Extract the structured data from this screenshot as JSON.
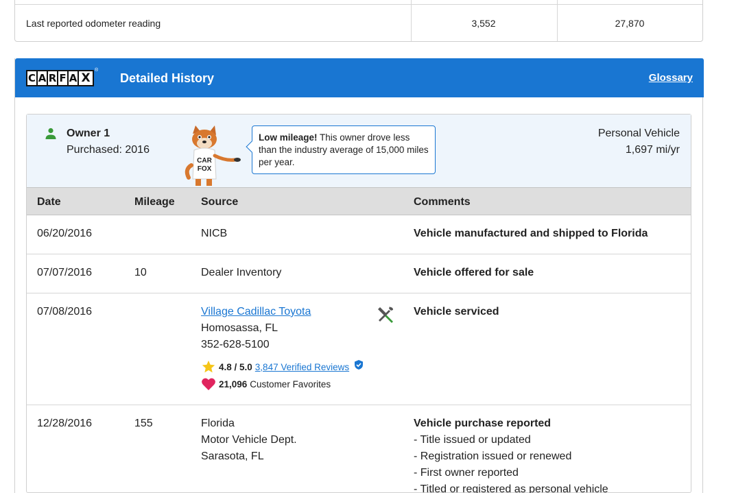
{
  "summary": {
    "label": "Last reported odometer reading",
    "values": [
      "3,552",
      "27,870"
    ]
  },
  "header": {
    "logo_letters": [
      "C",
      "A",
      "R",
      "F",
      "A",
      "X"
    ],
    "logo_reg": "®",
    "title": "Detailed History",
    "glossary": "Glossary"
  },
  "owner": {
    "title": "Owner 1",
    "purchased": "Purchased: 2016",
    "tooltip_bold": "Low mileage!",
    "tooltip_text": " This owner drove less than the industry average of 15,000 miles per year.",
    "vehicle_type": "Personal Vehicle",
    "mileage_rate": "1,697 mi/yr",
    "fox_shirt": [
      "CAR",
      "FOX"
    ]
  },
  "table": {
    "headers": {
      "date": "Date",
      "mileage": "Mileage",
      "source": "Source",
      "comments": "Comments"
    },
    "rows": [
      {
        "date": "06/20/2016",
        "mileage": "",
        "source": "NICB",
        "comment": "Vehicle manufactured and shipped to Florida"
      },
      {
        "date": "07/07/2016",
        "mileage": "10",
        "source": "Dealer Inventory",
        "comment": "Vehicle offered for sale"
      },
      {
        "date": "07/08/2016",
        "mileage": "",
        "source_link": "Village Cadillac Toyota",
        "source_city": "Homosassa, FL",
        "source_phone": "352-628-5100",
        "rating": "4.8 / 5.0",
        "reviews": "3,847 Verified Reviews",
        "favorites_count": "21,096",
        "favorites_label": "Customer Favorites",
        "comment": "Vehicle serviced"
      },
      {
        "date": "12/28/2016",
        "mileage": "155",
        "source_lines": [
          "Florida",
          "Motor Vehicle Dept.",
          "Sarasota, FL"
        ],
        "comment": "Vehicle purchase reported",
        "details": [
          "- Title issued or updated",
          "- Registration issued or renewed",
          "- First owner reported",
          "- Titled or registered as personal vehicle"
        ]
      }
    ]
  },
  "colors": {
    "brand_blue": "#1976d2",
    "star": "#f5c518",
    "heart": "#e0245e",
    "owner_icon": "#3a9a3a"
  }
}
